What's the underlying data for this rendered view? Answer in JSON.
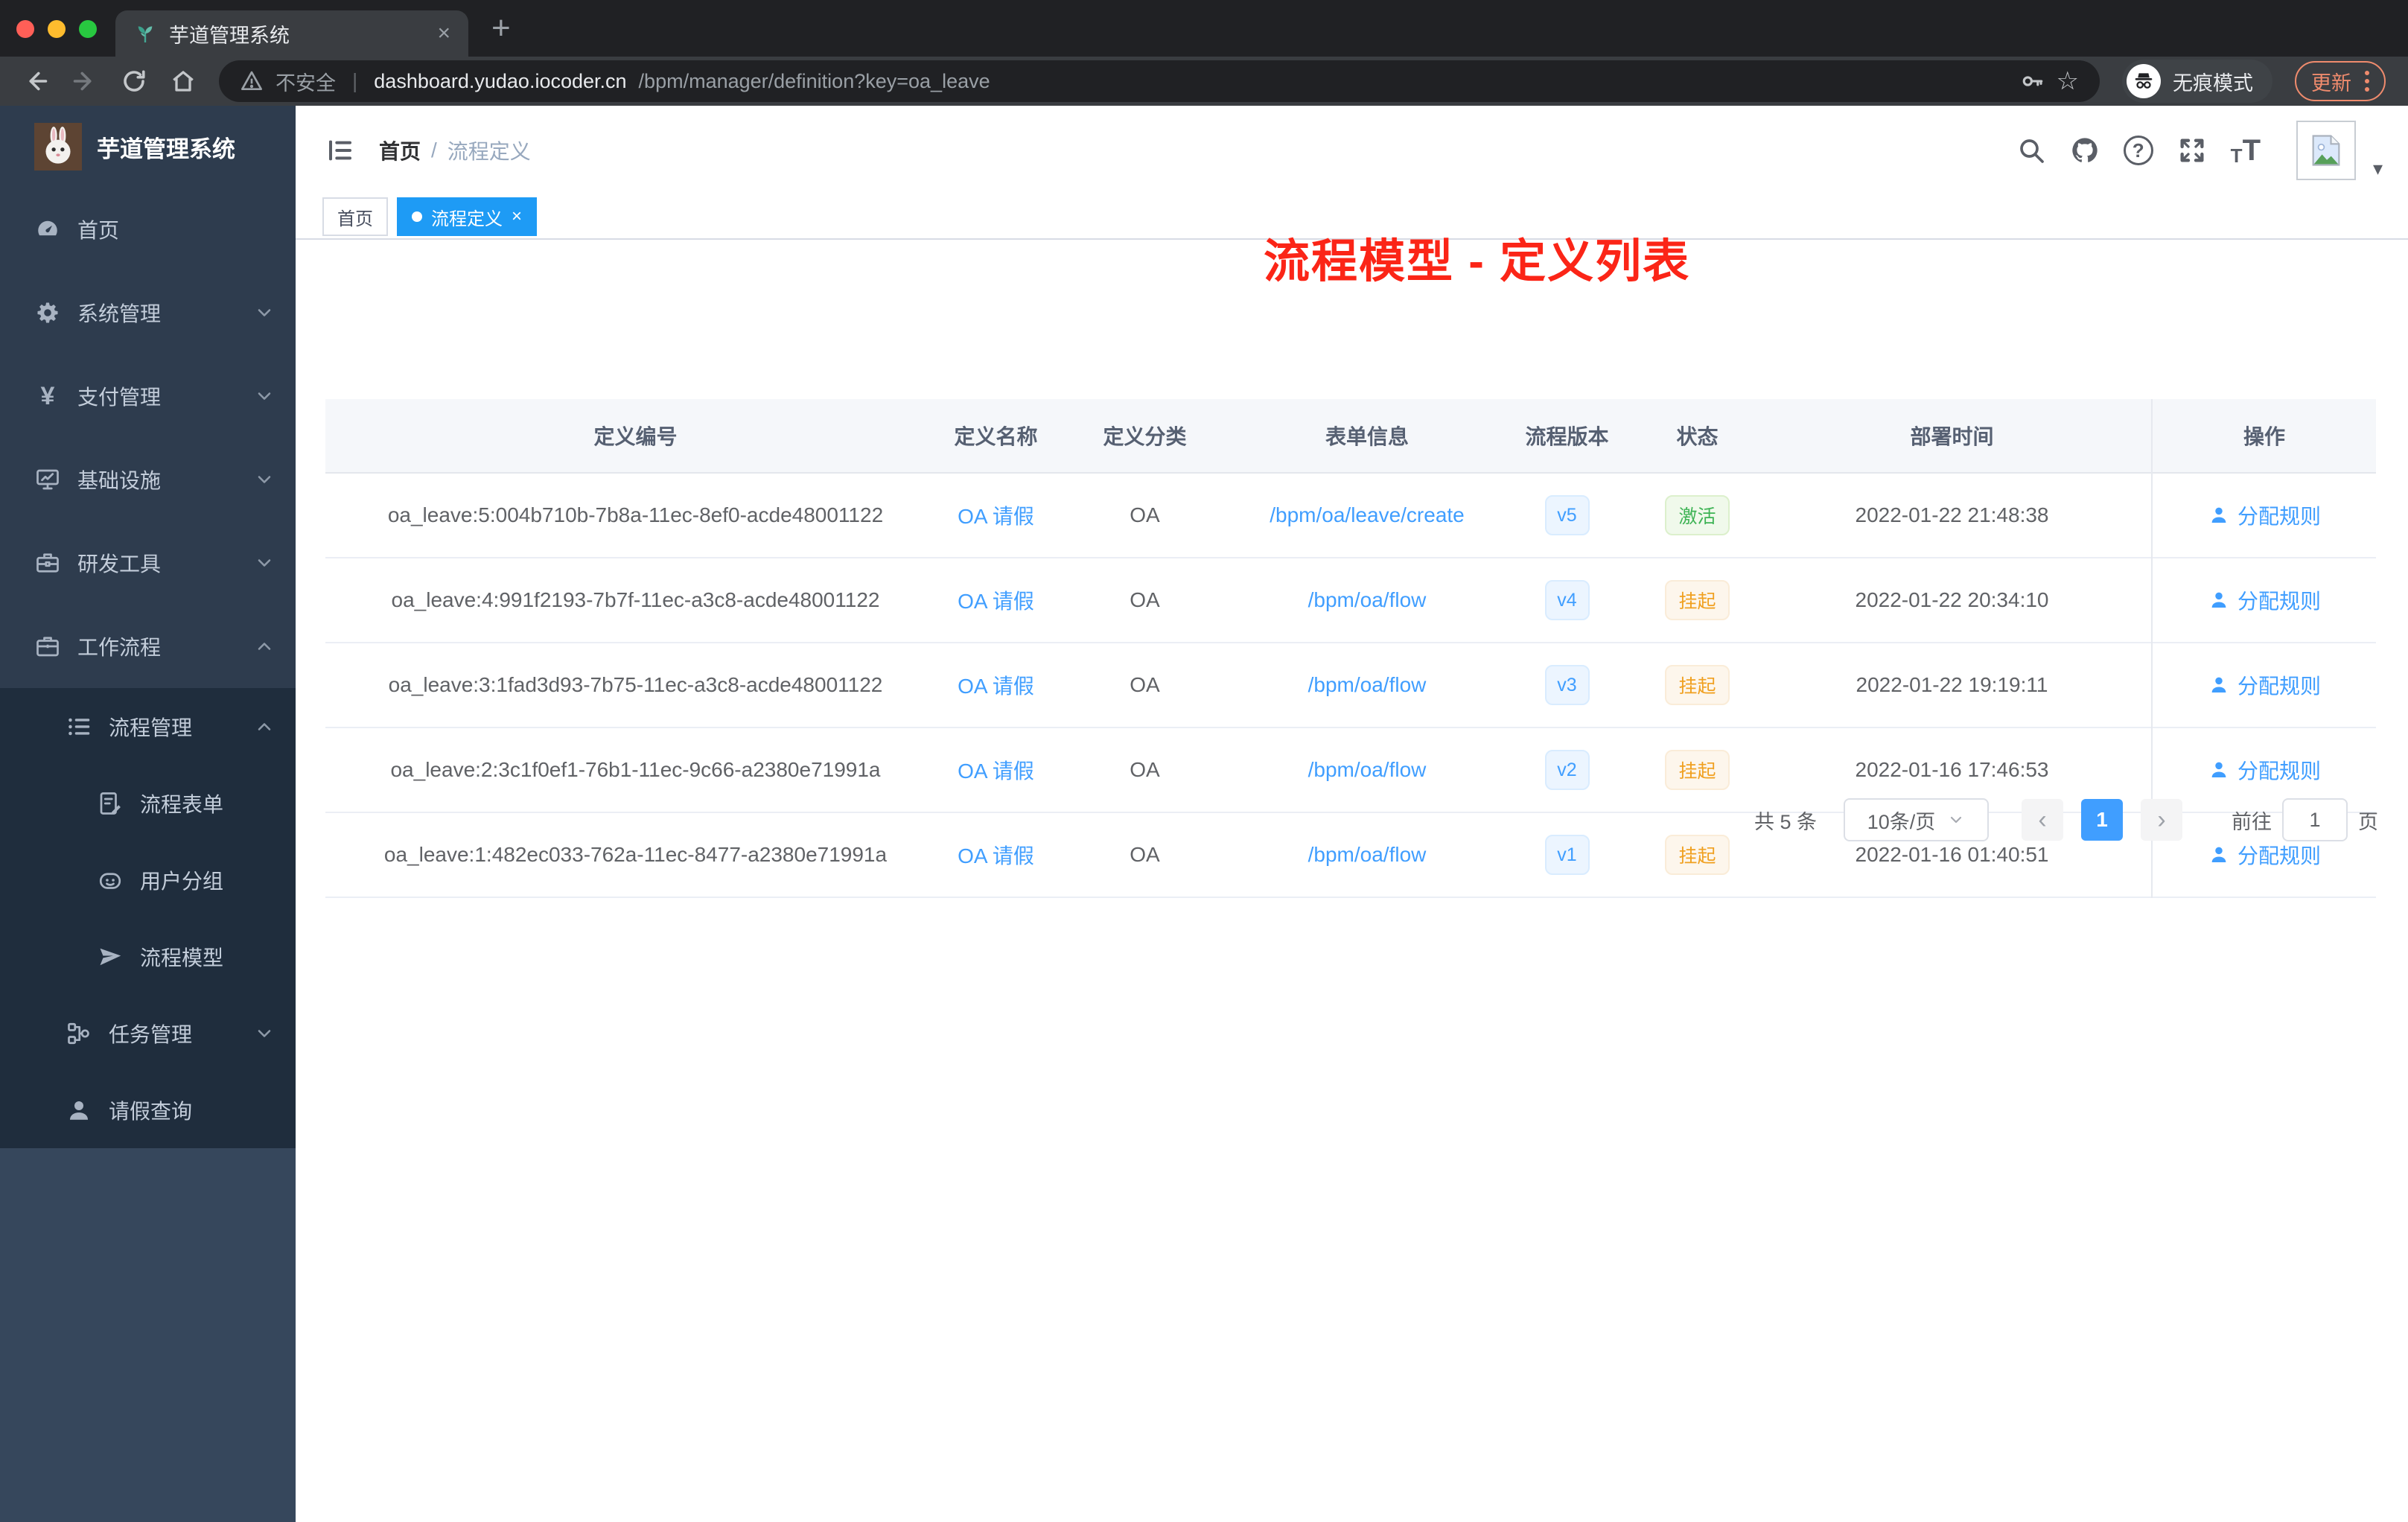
{
  "colors": {
    "primary_blue": "#409eff",
    "success_green": "#3db354",
    "warning_orange": "#f0a020",
    "annotation_red": "#fb2517",
    "active_tag_blue": "#1e9bf5",
    "sidebar_bg": "#2e3c4e",
    "submenu_bg": "#1f2d3d",
    "sidebar_lower_bg": "#36475c"
  },
  "icons": {
    "close_glyph": "×",
    "plus_glyph": "+",
    "star_glyph": "☆",
    "caret_glyph": "▾",
    "question_glyph": "?",
    "yen_glyph": "¥",
    "divider_glyph": "|",
    "font_size_small": "T",
    "font_size_large": "T"
  },
  "browser": {
    "tab": {
      "title": "芋道管理系统",
      "favicon": "sprout-icon"
    },
    "address": {
      "security_label": "不安全",
      "host": "dashboard.yudao.iocoder.cn",
      "path": "/bpm/manager/definition?key=oa_leave"
    },
    "incognito_label": "无痕模式",
    "update_button": "更新"
  },
  "sidebar": {
    "logo_title": "芋道管理系统",
    "menu": [
      {
        "label": "首页",
        "icon": "dashboard-icon",
        "chevron": "none"
      },
      {
        "label": "系统管理",
        "icon": "gear-icon",
        "chevron": "down"
      },
      {
        "label": "支付管理",
        "icon": "yen-icon",
        "chevron": "down"
      },
      {
        "label": "基础设施",
        "icon": "monitor-icon",
        "chevron": "down"
      },
      {
        "label": "研发工具",
        "icon": "toolbox-icon",
        "chevron": "down"
      },
      {
        "label": "工作流程",
        "icon": "briefcase-icon",
        "chevron": "up"
      }
    ],
    "submenu": [
      {
        "label": "流程管理",
        "icon": "workflow-list-icon",
        "chevron": "up",
        "level": 1
      },
      {
        "label": "流程表单",
        "icon": "form-edit-icon",
        "level": 2
      },
      {
        "label": "用户分组",
        "icon": "user-group-icon",
        "level": 2
      },
      {
        "label": "流程模型",
        "icon": "paper-plane-icon",
        "level": 2
      },
      {
        "label": "任务管理",
        "icon": "task-tree-icon",
        "chevron": "down",
        "level": 1
      },
      {
        "label": "请假查询",
        "icon": "user-icon",
        "level": 1
      }
    ]
  },
  "header": {
    "breadcrumb": {
      "items": [
        "首页",
        "流程定义"
      ],
      "separator": "/"
    },
    "annotation": "流程模型 - 定义列表"
  },
  "tags": [
    {
      "label": "首页",
      "active": false
    },
    {
      "label": "流程定义",
      "active": true
    }
  ],
  "table": {
    "columns": [
      "定义编号",
      "定义名称",
      "定义分类",
      "表单信息",
      "流程版本",
      "状态",
      "部署时间",
      "操作"
    ],
    "rows": [
      {
        "id": "oa_leave:5:004b710b-7b8a-11ec-8ef0-acde48001122",
        "name": "OA 请假",
        "category": "OA",
        "form": "/bpm/oa/leave/create",
        "version": "v5",
        "status": "激活",
        "deploy_time": "2022-01-22 21:48:38",
        "action": "分配规则"
      },
      {
        "id": "oa_leave:4:991f2193-7b7f-11ec-a3c8-acde48001122",
        "name": "OA 请假",
        "category": "OA",
        "form": "/bpm/oa/flow",
        "version": "v4",
        "status": "挂起",
        "deploy_time": "2022-01-22 20:34:10",
        "action": "分配规则"
      },
      {
        "id": "oa_leave:3:1fad3d93-7b75-11ec-a3c8-acde48001122",
        "name": "OA 请假",
        "category": "OA",
        "form": "/bpm/oa/flow",
        "version": "v3",
        "status": "挂起",
        "deploy_time": "2022-01-22 19:19:11",
        "action": "分配规则"
      },
      {
        "id": "oa_leave:2:3c1f0ef1-76b1-11ec-9c66-a2380e71991a",
        "name": "OA 请假",
        "category": "OA",
        "form": "/bpm/oa/flow",
        "version": "v2",
        "status": "挂起",
        "deploy_time": "2022-01-16 17:46:53",
        "action": "分配规则"
      },
      {
        "id": "oa_leave:1:482ec033-762a-11ec-8477-a2380e71991a",
        "name": "OA 请假",
        "category": "OA",
        "form": "/bpm/oa/flow",
        "version": "v1",
        "status": "挂起",
        "deploy_time": "2022-01-16 01:40:51",
        "action": "分配规则"
      }
    ]
  },
  "pagination": {
    "total": "共 5 条",
    "page_size": "10条/页",
    "prev_icon": "‹",
    "page": "1",
    "next_icon": "›",
    "goto_label": "前往",
    "goto_value": "1",
    "page_unit": "页"
  }
}
